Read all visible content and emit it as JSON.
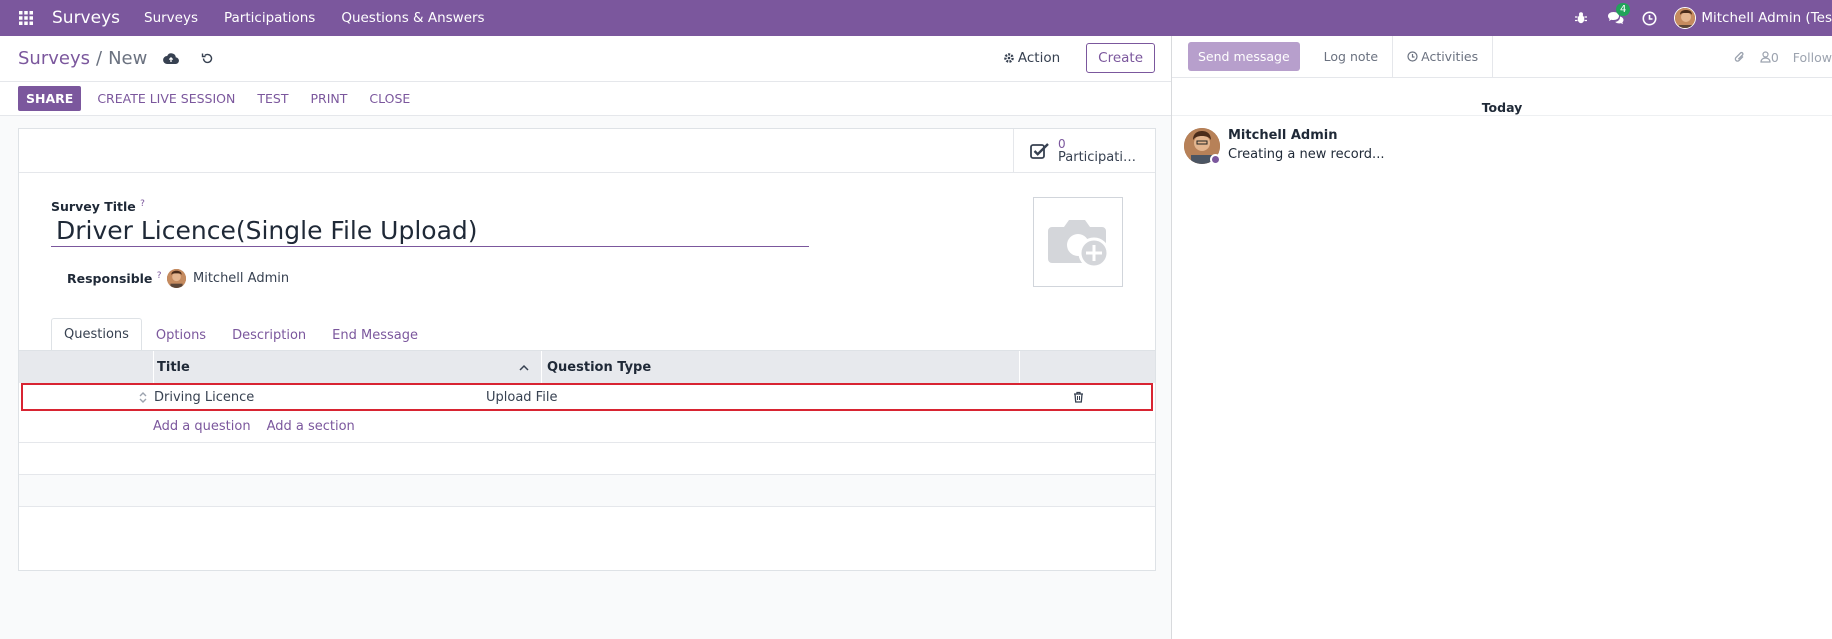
{
  "navbar": {
    "brand": "Surveys",
    "menu": [
      "Surveys",
      "Participations",
      "Questions & Answers"
    ],
    "messages_badge": "4",
    "user_name": "Mitchell Admin (Tes"
  },
  "control": {
    "breadcrumb_parent": "Surveys",
    "breadcrumb_sep": "/",
    "breadcrumb_current": "New",
    "action_label": "Action",
    "create_label": "Create"
  },
  "statusbar": {
    "share": "SHARE",
    "live": "CREATE LIVE SESSION",
    "test": "TEST",
    "print": "PRINT",
    "close": "CLOSE"
  },
  "form": {
    "participations_count": "0",
    "participations_label": "Participati…",
    "survey_title_label": "Survey Title",
    "help_mark": "?",
    "survey_title_value": "Driver Licence(Single File Upload)",
    "responsible_label": "Responsible",
    "responsible_value": "Mitchell Admin"
  },
  "tabs": [
    "Questions",
    "Options",
    "Description",
    "End Message"
  ],
  "table": {
    "headers": {
      "title": "Title",
      "type": "Question Type"
    },
    "rows": [
      {
        "title": "Driving Licence",
        "type": "Upload File"
      }
    ],
    "add_question": "Add a question",
    "add_section": "Add a section"
  },
  "chatter": {
    "send_message": "Send message",
    "log_note": "Log note",
    "activities": "Activities",
    "followers_count": "0",
    "follow": "Follow",
    "today": "Today",
    "message_author": "Mitchell Admin",
    "message_text": "Creating a new record..."
  },
  "colors": {
    "brand": "#7b579d",
    "highlight": "#d82432"
  }
}
